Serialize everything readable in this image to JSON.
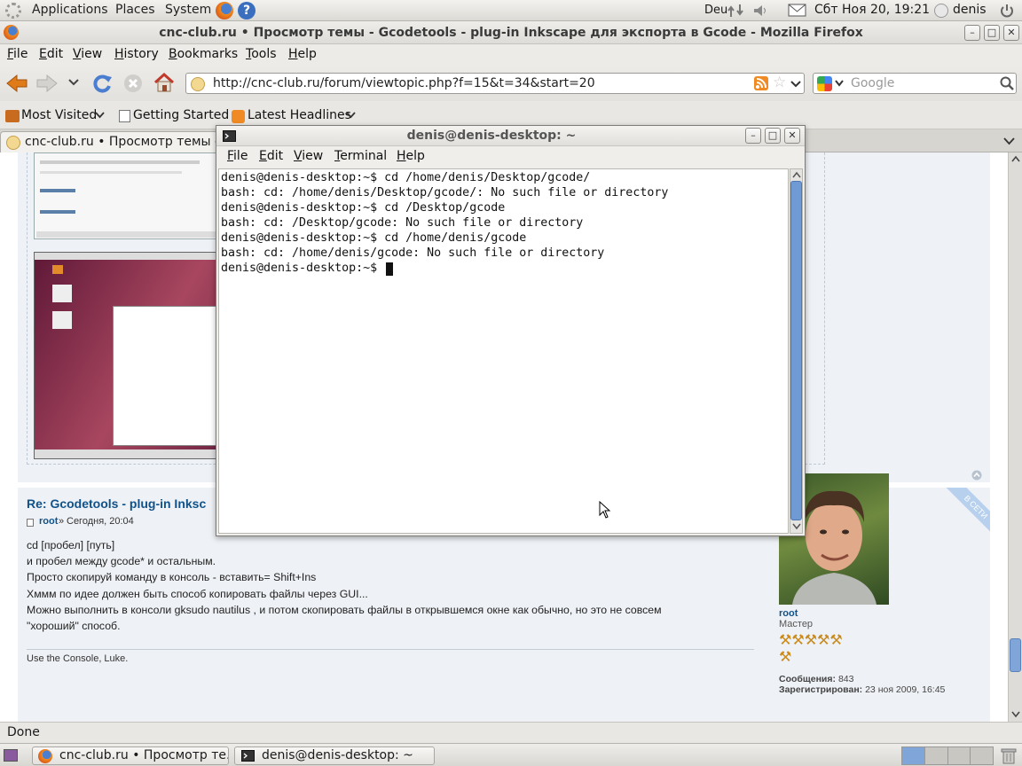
{
  "top_panel": {
    "menus": [
      "Applications",
      "Places",
      "System"
    ],
    "keyboard_layout": "Deu",
    "datetime": "Сбт Ноя 20, 19:21",
    "user": "denis"
  },
  "firefox": {
    "window_title": "cnc-club.ru • Просмотр темы - Gcodetools - plug-in Inkscape для экспорта в Gcode - Mozilla Firefox",
    "menus": [
      {
        "label": "File",
        "key": "F",
        "rest": "ile"
      },
      {
        "label": "Edit",
        "key": "E",
        "rest": "dit"
      },
      {
        "label": "View",
        "key": "V",
        "rest": "iew"
      },
      {
        "label": "History",
        "key": "H",
        "rest": "istory"
      },
      {
        "label": "Bookmarks",
        "key": "B",
        "rest": "ookmarks"
      },
      {
        "label": "Tools",
        "key": "T",
        "rest": "ools"
      },
      {
        "label": "Help",
        "key": "H",
        "rest": "elp"
      }
    ],
    "url": "http://cnc-club.ru/forum/viewtopic.php?f=15&t=34&start=20",
    "search_placeholder": "Google",
    "bookmarks": [
      "Most Visited",
      "Getting Started",
      "Latest Headlines"
    ],
    "tab_label": "cnc-club.ru • Просмотр темы -...",
    "status_text": "Done"
  },
  "forum_post": {
    "title": "Re: Gcodetools - plug-in Inksc",
    "author": "root",
    "date": "Сегодня, 20:04",
    "lines": [
      "cd [пробел] [путь]",
      "и пробел между gcode* и остальным.",
      "Просто скопируй команду в консоль - вставить= Shift+Ins",
      "Хммм по идее должен быть способ копировать файлы через GUI...",
      "Можно выполнить в консоли gksudo nautilus , и потом скопировать файлы в открывшемся окне как обычно, но это не совсем",
      "\"хороший\" способ."
    ],
    "signature": "Use the Console, Luke.",
    "online_badge": "В СЕТИ",
    "profile": {
      "name": "root",
      "rank": "Мастер",
      "posts_label": "Сообщения:",
      "posts": "843",
      "registered_label": "Зарегистрирован:",
      "registered": "23 ноя 2009, 16:45"
    }
  },
  "terminal": {
    "title": "denis@denis-desktop: ~",
    "menus": [
      {
        "label": "File",
        "key": "F",
        "rest": "ile"
      },
      {
        "label": "Edit",
        "key": "E",
        "rest": "dit"
      },
      {
        "label": "View",
        "key": "V",
        "rest": "iew"
      },
      {
        "label": "Terminal",
        "key": "T",
        "rest": "erminal"
      },
      {
        "label": "Help",
        "key": "H",
        "rest": "elp"
      }
    ],
    "lines": [
      "denis@denis-desktop:~$ cd /home/denis/Desktop/gcode/",
      "bash: cd: /home/denis/Desktop/gcode/: No such file or directory",
      "denis@denis-desktop:~$ cd /Desktop/gcode",
      "bash: cd: /Desktop/gcode: No such file or directory",
      "denis@denis-desktop:~$ cd /home/denis/gcode",
      "bash: cd: /home/denis/gcode: No such file or directory",
      "denis@denis-desktop:~$ "
    ]
  },
  "taskbar": {
    "tasks": [
      "cnc-club.ru • Просмотр те...",
      "denis@denis-desktop: ~"
    ]
  },
  "colors": {
    "accent_link": "#105289",
    "terminal_scroll": "#6f9ad4",
    "forum_bg": "#eef1f5",
    "online_badge": "#b6d0ee"
  }
}
